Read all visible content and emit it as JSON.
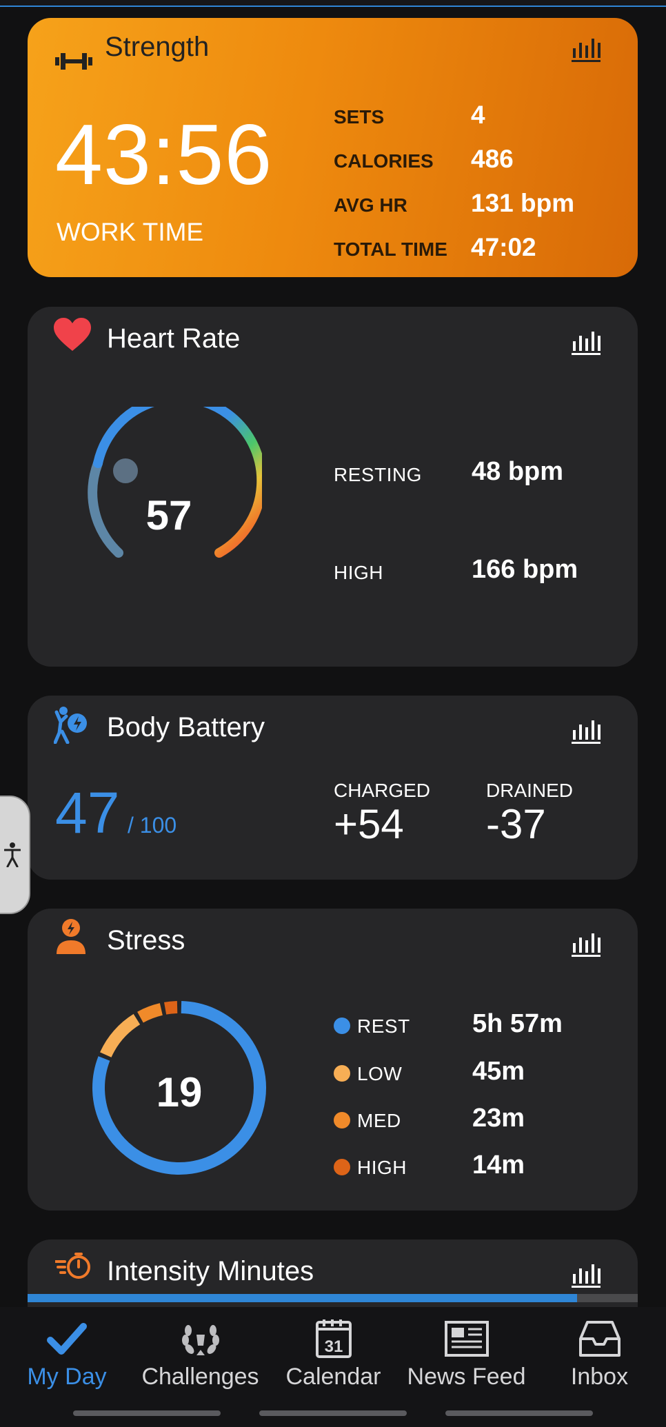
{
  "strength": {
    "title": "Strength",
    "work_time": "43:56",
    "work_time_label": "WORK TIME",
    "stats": [
      {
        "label": "SETS",
        "value": "4"
      },
      {
        "label": "CALORIES",
        "value": "486"
      },
      {
        "label": "AVG HR",
        "value": "131 bpm"
      },
      {
        "label": "TOTAL TIME",
        "value": "47:02"
      }
    ],
    "icon": "dumbbell-icon"
  },
  "heart_rate": {
    "title": "Heart Rate",
    "current": "57",
    "resting_label": "RESTING",
    "resting_value": "48 bpm",
    "high_label": "HIGH",
    "high_value": "166 bpm",
    "icon": "heart-icon",
    "color": "#f0424a"
  },
  "body_battery": {
    "title": "Body Battery",
    "value": "47",
    "max": "/ 100",
    "charged_label": "CHARGED",
    "charged_value": "+54",
    "drained_label": "DRAINED",
    "drained_value": "-37",
    "icon": "body-battery-icon",
    "accent": "#3b8fe6"
  },
  "stress": {
    "title": "Stress",
    "value": "19",
    "icon": "stress-person-icon",
    "levels": [
      {
        "label": "REST",
        "value": "5h 57m",
        "color": "#3b8fe6"
      },
      {
        "label": "LOW",
        "value": "45m",
        "color": "#f7ae55"
      },
      {
        "label": "MED",
        "value": "23m",
        "color": "#f08a2a"
      },
      {
        "label": "HIGH",
        "value": "14m",
        "color": "#dd6418"
      }
    ]
  },
  "intensity": {
    "title": "Intensity Minutes",
    "icon": "stopwatch-icon",
    "progress": 0.9
  },
  "tabs": [
    {
      "label": "My Day",
      "icon": "checkmark-icon",
      "active": true
    },
    {
      "label": "Challenges",
      "icon": "laurel-icon",
      "active": false
    },
    {
      "label": "Calendar",
      "icon": "calendar-icon",
      "active": false,
      "day": "31"
    },
    {
      "label": "News Feed",
      "icon": "newspaper-icon",
      "active": false
    },
    {
      "label": "Inbox",
      "icon": "inbox-icon",
      "active": false
    }
  ]
}
